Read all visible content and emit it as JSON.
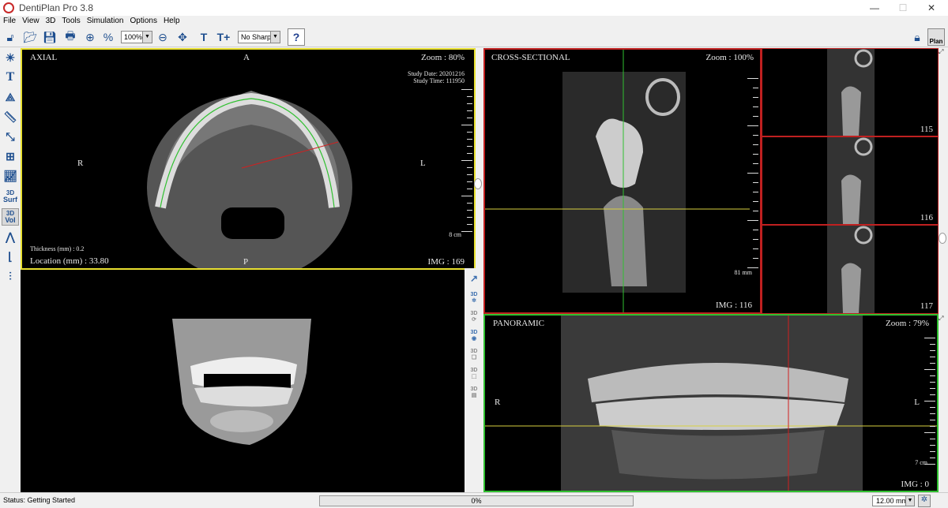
{
  "window": {
    "title": "DentiPlan Pro 3.8"
  },
  "menu": [
    "File",
    "View",
    "3D",
    "Tools",
    "Simulation",
    "Options",
    "Help"
  ],
  "toolbar": {
    "zoom_value": "100%",
    "sharpen_value": "No Sharp",
    "help_label": "?",
    "plan_label": "Plan",
    "text_tool": "T",
    "text_add_tool": "T+"
  },
  "left_tools": {
    "text_label": "T",
    "surf_top": "3D",
    "surf_bottom": "Surf",
    "vol_top": "3D",
    "vol_bottom": "Vol"
  },
  "mid_tools": {
    "label_3d": "3D"
  },
  "axial": {
    "title": "AXIAL",
    "top": "A",
    "bottom": "P",
    "left": "R",
    "right": "L",
    "zoom": "Zoom : 80%",
    "study_date": "Study Date: 20201216",
    "study_time": "Study Time: 111950",
    "scale": "8 cm",
    "thickness": "Thickness (mm) : 0.2",
    "location": "Location (mm) : 33.80",
    "img": "IMG : 169"
  },
  "cross": {
    "title": "CROSS-SECTIONAL",
    "zoom": "Zoom : 100%",
    "scale": "81 mm",
    "img": "IMG : 116"
  },
  "thumbs": [
    {
      "label": "115"
    },
    {
      "label": "116"
    },
    {
      "label": "117"
    }
  ],
  "panoramic": {
    "title": "PANORAMIC",
    "zoom": "Zoom : 79%",
    "left": "R",
    "right": "L",
    "scale": "7 cm",
    "img": "IMG : 0"
  },
  "status": {
    "text": "Status: Getting Started",
    "progress": "0%",
    "progress_value": 0,
    "slice_thickness": "12.00 mm"
  },
  "colors": {
    "axial_border": "#e8e030",
    "cross_border": "#c02020",
    "panoramic_border": "#30c030",
    "guide_yellow": "#d8d040",
    "guide_green": "#30c030",
    "guide_red": "#d02020"
  }
}
